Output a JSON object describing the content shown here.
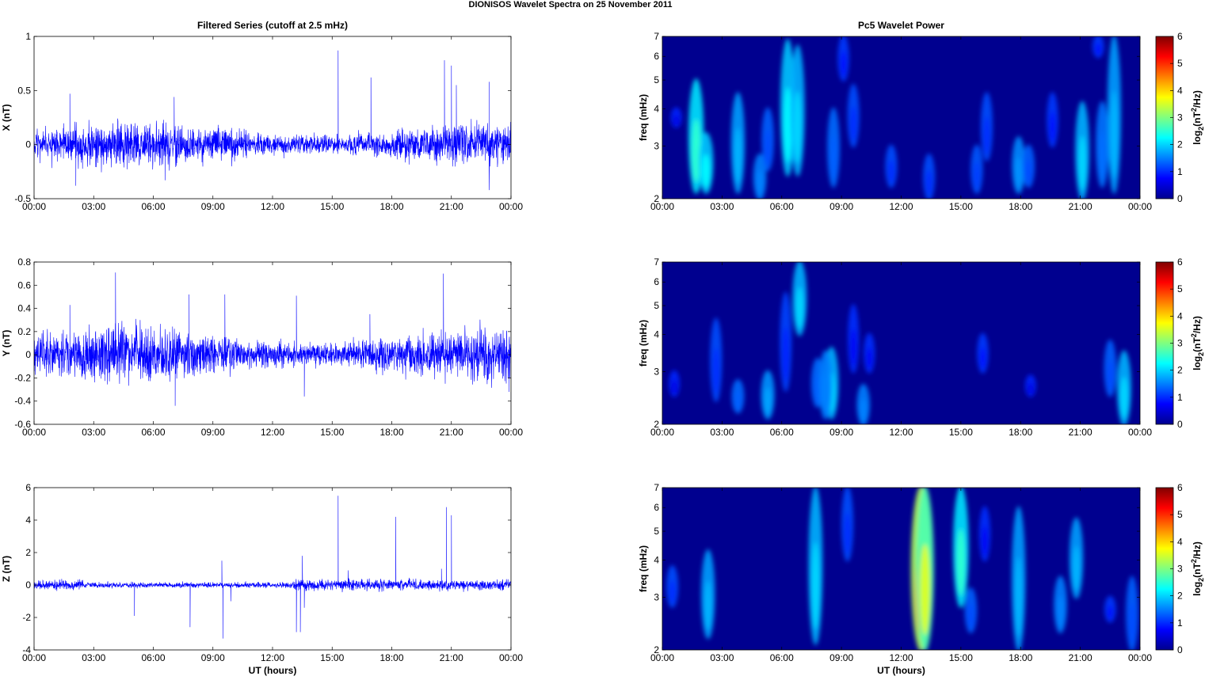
{
  "title": "DIONISOS Wavelet Spectra on 25 November  2011",
  "chart_data": [
    {
      "type": "line",
      "title": "Filtered Series (cutoff at 2.5 mHz)",
      "ylabel": "X (nT)",
      "xlabel": "",
      "ylim": [
        -0.5,
        1
      ],
      "yticks": [
        "-0.5",
        "0",
        "0.5",
        "1"
      ],
      "ytick_values": [
        -0.5,
        0,
        0.5,
        1
      ],
      "xlim": [
        0,
        24
      ],
      "xticks": [
        "00:00",
        "03:00",
        "06:00",
        "09:00",
        "12:00",
        "15:00",
        "18:00",
        "21:00",
        "00:00"
      ],
      "color": "#0000ff",
      "noise_sigma": 0.07,
      "seed": 11,
      "spikes": [
        [
          15.3,
          0.87
        ],
        [
          20.65,
          0.78
        ],
        [
          21.0,
          0.73
        ],
        [
          16.95,
          0.62
        ],
        [
          1.8,
          0.47
        ],
        [
          7.05,
          0.44
        ],
        [
          22.9,
          0.58
        ],
        [
          21.25,
          0.55
        ],
        [
          22.9,
          -0.42
        ],
        [
          2.1,
          -0.38
        ],
        [
          6.6,
          -0.33
        ]
      ]
    },
    {
      "type": "line",
      "title": "",
      "ylabel": "Y (nT)",
      "xlabel": "",
      "ylim": [
        -0.6,
        0.8
      ],
      "yticks": [
        "-0.6",
        "-0.4",
        "-0.2",
        "0",
        "0.2",
        "0.4",
        "0.6",
        "0.8"
      ],
      "ytick_values": [
        -0.6,
        -0.4,
        -0.2,
        0,
        0.2,
        0.4,
        0.6,
        0.8
      ],
      "xlim": [
        0,
        24
      ],
      "xticks": [
        "00:00",
        "03:00",
        "06:00",
        "09:00",
        "12:00",
        "15:00",
        "18:00",
        "21:00",
        "00:00"
      ],
      "color": "#0000ff",
      "noise_sigma": 0.08,
      "seed": 23,
      "spikes": [
        [
          4.1,
          0.71
        ],
        [
          20.6,
          0.7
        ],
        [
          7.1,
          -0.44
        ],
        [
          7.8,
          0.52
        ],
        [
          9.6,
          0.52
        ],
        [
          13.2,
          0.51
        ],
        [
          13.6,
          -0.36
        ],
        [
          1.8,
          0.43
        ],
        [
          16.9,
          0.35
        ],
        [
          23.9,
          -0.32
        ]
      ]
    },
    {
      "type": "line",
      "title": "",
      "ylabel": "Z (nT)",
      "xlabel": "UT (hours)",
      "ylim": [
        -4,
        6
      ],
      "yticks": [
        "-4",
        "-2",
        "0",
        "2",
        "4",
        "6"
      ],
      "ytick_values": [
        -4,
        -2,
        0,
        2,
        4,
        6
      ],
      "xlim": [
        0,
        24
      ],
      "xticks": [
        "00:00",
        "03:00",
        "06:00",
        "09:00",
        "12:00",
        "15:00",
        "18:00",
        "21:00",
        "00:00"
      ],
      "color": "#0000ff",
      "noise_sigma": 0.09,
      "seed": 37,
      "spikes": [
        [
          15.3,
          5.5
        ],
        [
          20.75,
          4.8
        ],
        [
          18.2,
          4.2
        ],
        [
          21.0,
          4.3
        ],
        [
          13.5,
          1.8
        ],
        [
          9.45,
          1.5
        ],
        [
          9.5,
          -3.3
        ],
        [
          7.85,
          -2.6
        ],
        [
          5.05,
          -1.9
        ],
        [
          9.9,
          -1.0
        ],
        [
          13.2,
          -2.9
        ],
        [
          13.4,
          -2.9
        ],
        [
          15.8,
          0.9
        ],
        [
          20.5,
          1.0
        ],
        [
          13.6,
          -1.4
        ]
      ]
    },
    {
      "type": "heatmap",
      "title": "Pc5 Wavelet Power",
      "ylabel": "freq (mHz)",
      "xlabel": "",
      "ylim": [
        2,
        7
      ],
      "yscale": "log",
      "yticks": [
        "2",
        "3",
        "4",
        "5",
        "6",
        "7"
      ],
      "ytick_values": [
        2,
        3,
        4,
        5,
        6,
        7
      ],
      "xlim": [
        0,
        24
      ],
      "xticks": [
        "00:00",
        "03:00",
        "06:00",
        "09:00",
        "12:00",
        "15:00",
        "18:00",
        "21:00",
        "00:00"
      ],
      "colorbar": {
        "label": "log2(nT2/Hz)",
        "label_main": "log",
        "label_sub": "2",
        "label_rest": "(nT",
        "label_sup": "2",
        "label_end": "/Hz)",
        "range": [
          0,
          6
        ],
        "ticks": [
          "0",
          "1",
          "2",
          "3",
          "4",
          "5",
          "6"
        ]
      },
      "blobs_hour_fmin_fmax_power": [
        [
          1.7,
          2.1,
          5,
          2.5
        ],
        [
          2.2,
          2.1,
          3.3,
          2.2
        ],
        [
          3.8,
          2.1,
          4.5,
          1.8
        ],
        [
          4.9,
          2.0,
          2.8,
          1.5
        ],
        [
          5.3,
          2.5,
          4,
          1.2
        ],
        [
          6.3,
          2.4,
          6.8,
          2.2
        ],
        [
          6.8,
          2.4,
          6.5,
          2
        ],
        [
          8.6,
          2.2,
          4.0,
          1.3
        ],
        [
          9.6,
          3,
          4.8,
          1
        ],
        [
          11.5,
          2.2,
          3,
          1
        ],
        [
          13.4,
          2.0,
          2.8,
          1
        ],
        [
          15.8,
          2.1,
          3,
          1.1
        ],
        [
          16.3,
          2.7,
          4.5,
          1
        ],
        [
          17.9,
          2.1,
          3.2,
          1.6
        ],
        [
          18.4,
          2.2,
          3,
          1.2
        ],
        [
          19.6,
          3,
          4.5,
          0.8
        ],
        [
          21.1,
          2.0,
          4.2,
          2
        ],
        [
          22.1,
          2.2,
          4.2,
          1.4
        ],
        [
          22.7,
          2.1,
          7,
          1.8
        ],
        [
          21.9,
          6,
          7,
          0.8
        ],
        [
          0.7,
          3.5,
          4,
          0.6
        ],
        [
          9.1,
          5,
          7,
          0.8
        ]
      ]
    },
    {
      "type": "heatmap",
      "title": "",
      "ylabel": "freq (mHz)",
      "xlabel": "",
      "ylim": [
        2,
        7
      ],
      "yscale": "log",
      "yticks": [
        "2",
        "3",
        "4",
        "5",
        "6",
        "7"
      ],
      "ytick_values": [
        2,
        3,
        4,
        5,
        6,
        7
      ],
      "xlim": [
        0,
        24
      ],
      "xticks": [
        "00:00",
        "03:00",
        "06:00",
        "09:00",
        "12:00",
        "15:00",
        "18:00",
        "21:00",
        "00:00"
      ],
      "colorbar": {
        "label": "log2(nT2/Hz)",
        "label_main": "log",
        "label_sub": "2",
        "label_rest": "(nT",
        "label_sup": "2",
        "label_end": "/Hz)",
        "range": [
          0,
          6
        ],
        "ticks": [
          "0",
          "1",
          "2",
          "3",
          "4",
          "5",
          "6"
        ]
      },
      "blobs_hour_fmin_fmax_power": [
        [
          2.7,
          2.4,
          4.5,
          1
        ],
        [
          3.8,
          2.2,
          2.8,
          1.3
        ],
        [
          5.3,
          2.1,
          3,
          1.7
        ],
        [
          6.2,
          2.6,
          5.5,
          0.9
        ],
        [
          6.9,
          4,
          7,
          2
        ],
        [
          7.8,
          2.3,
          3.3,
          1.3
        ],
        [
          8.5,
          2.1,
          3.6,
          2
        ],
        [
          8.2,
          2.1,
          3.5,
          1.5
        ],
        [
          10.1,
          2.0,
          2.7,
          1.5
        ],
        [
          9.6,
          3,
          5,
          0.7
        ],
        [
          10.4,
          3,
          4,
          0.7
        ],
        [
          16.1,
          3,
          4,
          0.8
        ],
        [
          18.5,
          2.5,
          2.9,
          0.6
        ],
        [
          22.5,
          2.5,
          3.8,
          1.2
        ],
        [
          23.2,
          2.0,
          3.5,
          2
        ],
        [
          0.6,
          2.5,
          3,
          0.6
        ]
      ]
    },
    {
      "type": "heatmap",
      "title": "",
      "ylabel": "freq (mHz)",
      "xlabel": "UT (hours)",
      "ylim": [
        2,
        7
      ],
      "yscale": "log",
      "yticks": [
        "2",
        "3",
        "4",
        "5",
        "6",
        "7"
      ],
      "ytick_values": [
        2,
        3,
        4,
        5,
        6,
        7
      ],
      "xlim": [
        0,
        24
      ],
      "xticks": [
        "00:00",
        "03:00",
        "06:00",
        "09:00",
        "12:00",
        "15:00",
        "18:00",
        "21:00",
        "00:00"
      ],
      "colorbar": {
        "label": "log2(nT2/Hz)",
        "label_main": "log",
        "label_sub": "2",
        "label_rest": "(nT",
        "label_sup": "2",
        "label_end": "/Hz)",
        "range": [
          0,
          6
        ],
        "ticks": [
          "0",
          "1",
          "2",
          "3",
          "4",
          "5",
          "6"
        ]
      },
      "blobs_hour_fmin_fmax_power": [
        [
          0.5,
          2.8,
          3.8,
          1
        ],
        [
          2.3,
          2.2,
          4.3,
          1.8
        ],
        [
          7.7,
          2.1,
          7,
          2
        ],
        [
          9.3,
          4,
          7,
          1
        ],
        [
          13.0,
          2,
          7,
          4.5
        ],
        [
          13.2,
          2,
          7,
          3.5
        ],
        [
          15.0,
          2.8,
          7,
          2.5
        ],
        [
          15.5,
          2.3,
          3.2,
          1.2
        ],
        [
          16.2,
          4,
          6,
          0.7
        ],
        [
          17.9,
          2.0,
          6,
          1.8
        ],
        [
          20.0,
          2.3,
          3.5,
          1.5
        ],
        [
          20.8,
          3,
          5.5,
          1.8
        ],
        [
          22.5,
          2.5,
          3,
          0.8
        ],
        [
          23.6,
          2,
          3.5,
          1.2
        ]
      ]
    }
  ]
}
